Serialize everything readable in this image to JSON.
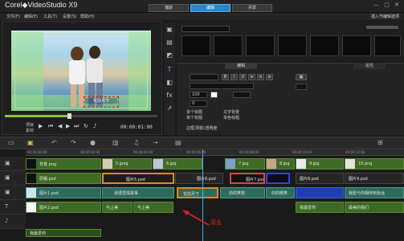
{
  "app": {
    "brand": "Corel",
    "product": "VideoStudio X9",
    "steps": [
      "捕获",
      "编辑",
      "共享"
    ],
    "active_step": "编辑",
    "window_controls": "— □ ✕"
  },
  "menu": [
    "文件(F)",
    "编辑(E)",
    "工具(T)",
    "设置(S)",
    "帮助(H)"
  ],
  "project_info": "插入节编辑选项",
  "preview": {
    "title_text": "花前月下",
    "mode_project": "项目",
    "mode_clip": "素材",
    "timecode": "00:00:01:00"
  },
  "options": {
    "tab_edit": "编辑",
    "tab_attr": "属性",
    "rows": [
      "单色标题",
      "文字背景",
      "多个标题",
      "单个标题",
      "边框/阴影/透明度",
      "文字背景"
    ],
    "font_size": "100",
    "angle": "0"
  },
  "timeline": {
    "ruler_labels": [
      "00:00:00:00",
      "00:00:02:00",
      "00:00:04:00",
      "00:00:06:00",
      "00:00:08:00",
      "00:00:10:00",
      "00:00:12:00"
    ],
    "tracks": [
      {
        "name": "video",
        "icon": "▣"
      },
      {
        "name": "overlay1",
        "icon": "▣"
      },
      {
        "name": "overlay2",
        "icon": "▣"
      },
      {
        "name": "title",
        "icon": "T"
      },
      {
        "name": "audio",
        "icon": "♪"
      }
    ],
    "clips": {
      "v1": "背景.png",
      "v2": "5.jpeg",
      "v3": "6.jpg",
      "v4": "7.jpg",
      "v5": "8.jpg",
      "v6": "9.jpg",
      "v7": "10.png",
      "o1": "原稿.psd",
      "o2": "图片5.psd",
      "o3": "图片6.psd",
      "o4": "图片7.psd",
      "o5": "图片8.psd",
      "o6": "图片9.psd",
      "p1": "图片1.psd",
      "p2": "图片2.psd",
      "t1": "浪漫爱情故事",
      "t2": "花前月下",
      "t3": "你的笑容",
      "t4": "你的微笑",
      "t5": "我最爱你",
      "t6": "我愿与你相伴到永远",
      "a1": "与上美",
      "a2": "与上美",
      "a3": "我最爱你",
      "a4": "最美的我们"
    },
    "annotation": "双击"
  }
}
